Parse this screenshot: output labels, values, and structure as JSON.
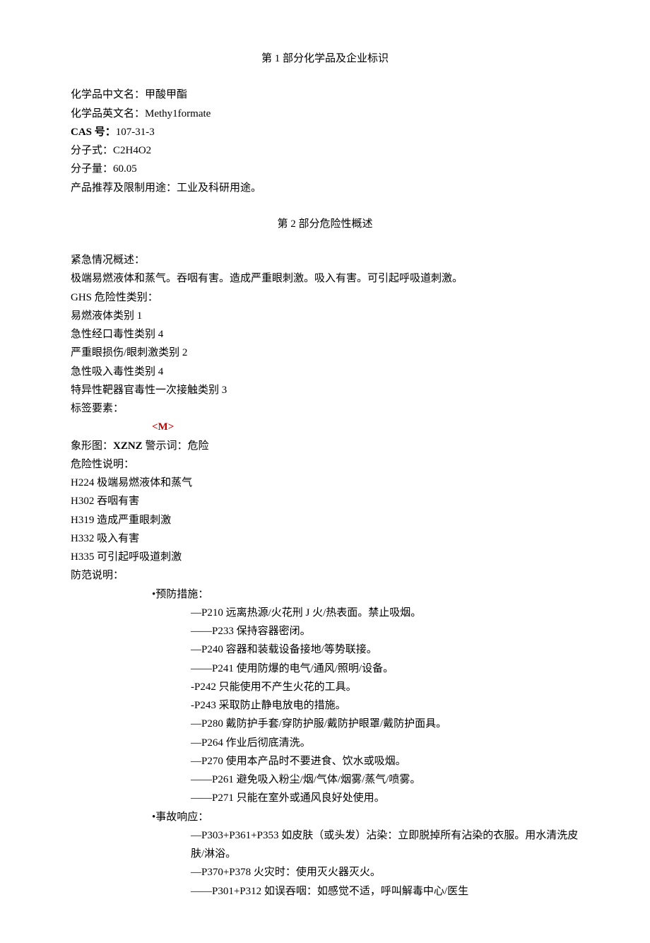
{
  "section1": {
    "title": "第 1 部分化学品及企业标识",
    "rows": [
      {
        "label": "化学品中文名：",
        "value": "甲酸甲酯",
        "bold": false
      },
      {
        "label": "化学品英文名：",
        "value": "Methy1formate",
        "bold": false
      },
      {
        "label": "CAS 号：",
        "value": "107-31-3",
        "bold": true
      },
      {
        "label": "分子式：",
        "value": "C2H4O2",
        "bold": false
      },
      {
        "label": "分子量：",
        "value": "60.05",
        "bold": false
      },
      {
        "label": "产品推荐及限制用途：",
        "value": "工业及科研用途。",
        "bold": false
      }
    ]
  },
  "section2": {
    "title": "第 2 部分危险性概述",
    "emergency_label": "紧急情况概述：",
    "emergency_text": "极端易燃液体和蒸气。吞咽有害。造成严重眼刺激。吸入有害。可引起呼吸道刺激。",
    "ghs_label": "GHS 危险性类别：",
    "ghs_categories": [
      "易燃液体类别 1",
      "急性经口毒性类别 4",
      "严重眼损伤/眼刺激类别 2",
      "急性吸入毒性类别 4",
      "特异性靶器官毒性一次接触类别 3"
    ],
    "label_elements": "标签要素：",
    "m_tag": "<M>",
    "pictogram_prefix": "象形图：",
    "pictogram_code": "XZNZ",
    "signal_word": " 警示词：危险",
    "hazard_label": "危险性说明：",
    "hazard_statements": [
      "H224 极端易燃液体和蒸气",
      "H302 吞咽有害",
      "H319 造成严重眼刺激",
      "H332 吸入有害",
      "H335 可引起呼吸道刺激"
    ],
    "precaution_label": "防范说明：",
    "prevention_header": "•预防措施：",
    "prevention_items": [
      "—P210 远离热源/火花刑 J 火/热表面。禁止吸烟。",
      "——P233 保持容器密闭。",
      "—P240 容器和装载设备接地/等势联接。",
      "——P241 使用防爆的电气/通风/照明/设备。",
      "-P242 只能使用不产生火花的工具。",
      "-P243 采取防止静电放电的措施。",
      "—P280 戴防护手套/穿防护服/戴防护眼罩/戴防护面具。",
      "—P264 作业后彻底清洗。",
      "—P270 使用本产品时不要进食、饮水或吸烟。",
      "——P261 避免吸入粉尘/烟/气体/烟雾/蒸气/喷雾。",
      "——P271 只能在室外或通风良好处使用。"
    ],
    "response_header": "•事故响应：",
    "response_items": [
      "—P303+P361+P353 如皮肤（或头发）沾染：立即脱掉所有沾染的衣服。用水清洗皮肤/淋浴。",
      "—P370+P378 火灾时：使用灭火器灭火。",
      "——P301+P312 如误吞咽：如感觉不适，呼叫解毒中心/医生"
    ]
  }
}
